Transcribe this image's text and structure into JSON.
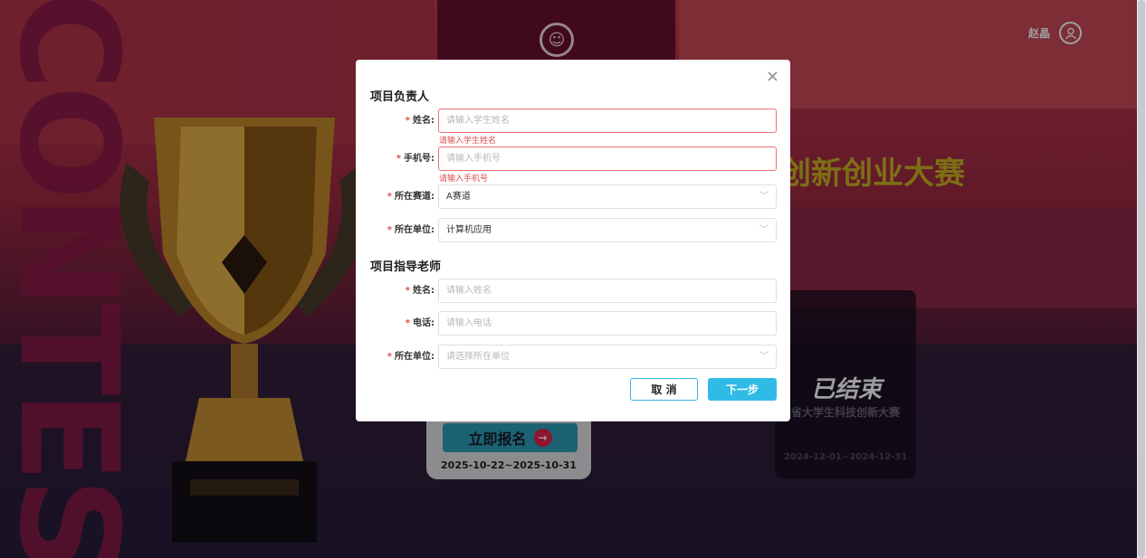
{
  "background": {
    "contest_text": "CONTEST",
    "user": {
      "name": "赵晶",
      "avatar_icon": "user-circle-icon"
    },
    "hero_title": "创新创业大赛",
    "active_card": {
      "button_label": "立即报名",
      "date_range": "2025-10-22~2025-10-31"
    },
    "ended_card": {
      "stamp": "已结束",
      "title": "东省大学生科技创新大赛",
      "date_range": "2024-12-01~2024-12-31"
    }
  },
  "modal": {
    "close_icon": "close-icon",
    "leader_section": {
      "title": "项目负责人",
      "fields": [
        {
          "label": "姓名:",
          "placeholder": "请输入学生姓名",
          "error": "请输入学生姓名"
        },
        {
          "label": "手机号:",
          "placeholder": "请输入手机号",
          "error": "请输入手机号"
        },
        {
          "label": "所在赛道:",
          "value": "A赛道"
        },
        {
          "label": "所在单位:",
          "value": "计算机应用"
        }
      ]
    },
    "teacher_section": {
      "title": "项目指导老师",
      "fields": [
        {
          "label": "姓名:",
          "placeholder": "请输入姓名"
        },
        {
          "label": "电话:",
          "placeholder": "请输入电话"
        },
        {
          "label": "所在单位:",
          "placeholder": "请选择所在单位"
        }
      ]
    },
    "buttons": {
      "cancel": "取 消",
      "next": "下一步"
    }
  }
}
